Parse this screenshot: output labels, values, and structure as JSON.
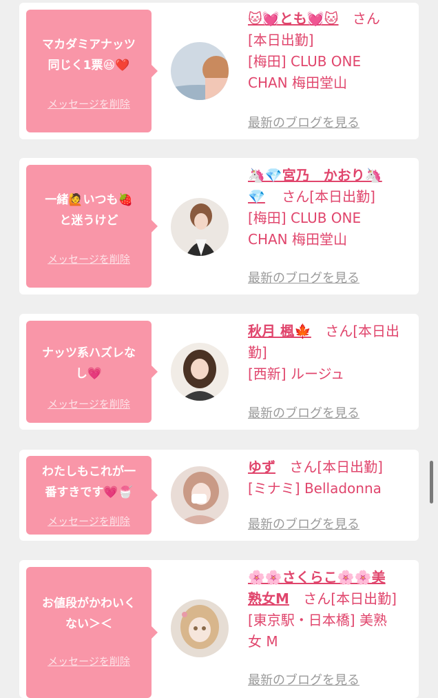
{
  "delete_label": "メッセージを削除",
  "blog_label": "最新のブログを見る",
  "entries": [
    {
      "message": [
        "マカダミアナッツ",
        "同じく1票😆❤️"
      ],
      "name": "🐱💓とも💓🐱",
      "suffix": "さん",
      "status": "[本日出勤]",
      "shop": [
        "[梅田] CLUB ONE",
        "CHAN 梅田堂山"
      ]
    },
    {
      "message": [
        "一緒🙋いつも🍓",
        "と迷うけど"
      ],
      "name": "🦄💎宮乃　かおり🦄",
      "name_cont": "💎",
      "suffix": "さん[本日出勤]",
      "shop": [
        "[梅田] CLUB ONE",
        "CHAN 梅田堂山"
      ]
    },
    {
      "message": [
        "ナッツ系ハズレな",
        "し💗"
      ],
      "name": "秋月 楓🍁",
      "suffix": "さん[本日出",
      "suffix_cont": "勤]",
      "shop": [
        "[西新] ルージュ"
      ]
    },
    {
      "message": [
        "わたしもこれが一",
        "番すきです💗🍧"
      ],
      "name": "ゆず",
      "suffix": "さん[本日出勤]",
      "shop": [
        "[ミナミ] Belladonna"
      ]
    },
    {
      "message": [
        "お値段がかわいく",
        "ない＞＜"
      ],
      "name": "🌸🌸さくらこ🌸🌸美",
      "name_cont": "熟女M",
      "suffix": "さん[本日出勤]",
      "shop": [
        "[東京駅・日本橋] 美熟",
        "女 M"
      ]
    }
  ],
  "colors": {
    "accent": "#e0456c",
    "bubble": "#f996a8",
    "background": "#efefef"
  }
}
